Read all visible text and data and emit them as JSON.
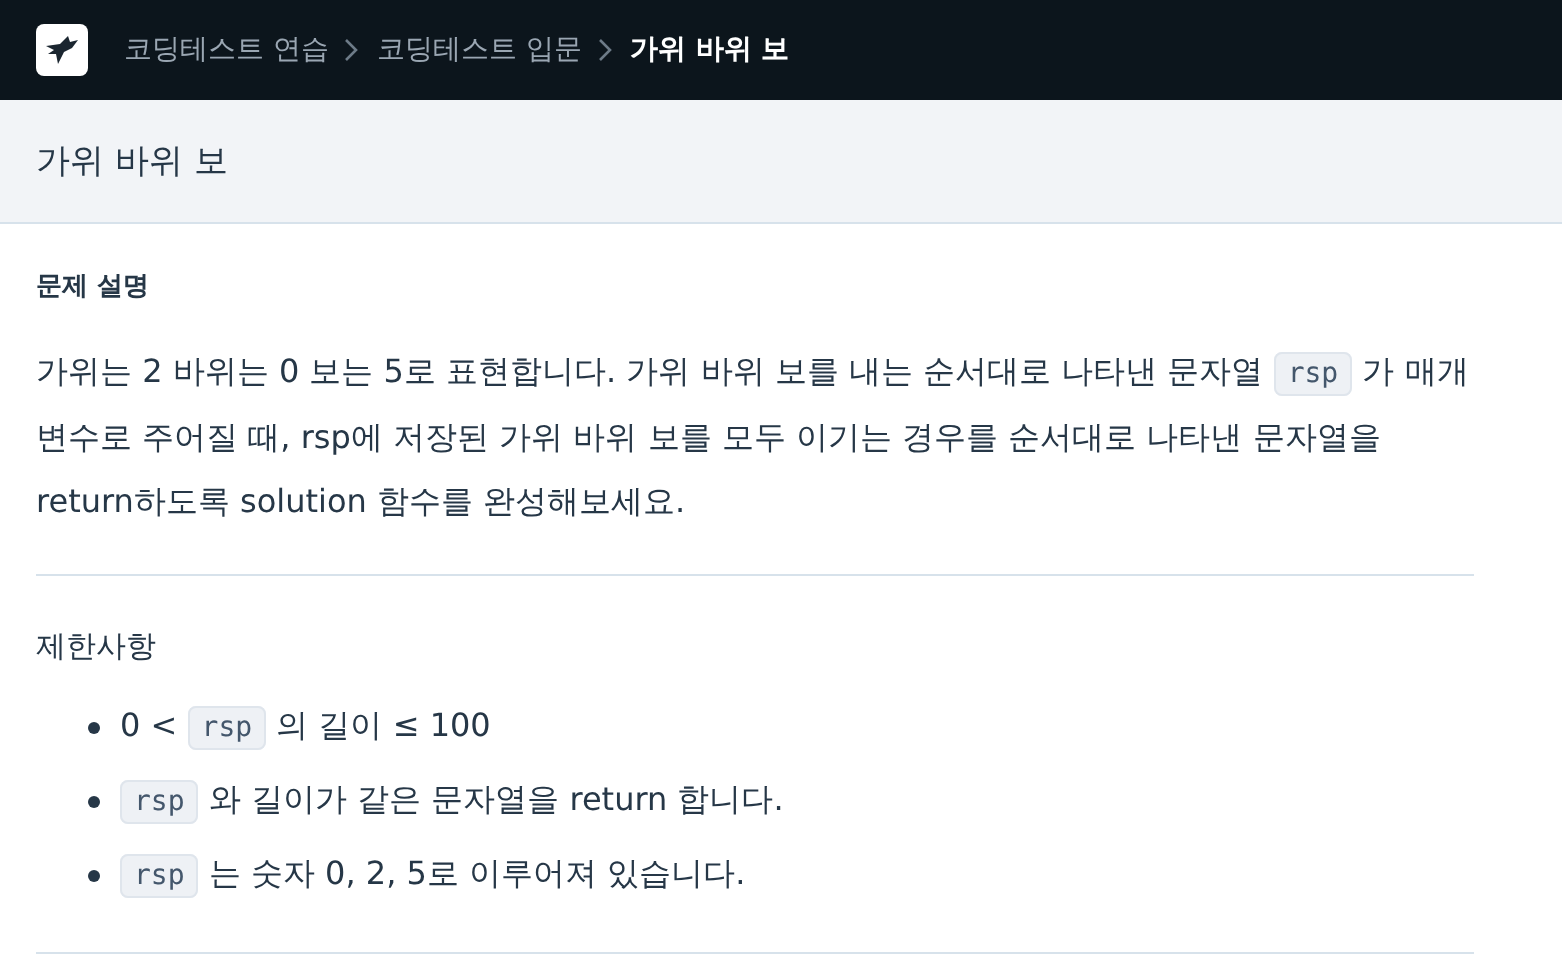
{
  "breadcrumb": [
    {
      "label": "코딩테스트 연습",
      "current": false
    },
    {
      "label": "코딩테스트 입문",
      "current": false
    },
    {
      "label": "가위 바위 보",
      "current": true
    }
  ],
  "title": "가위 바위 보",
  "description": {
    "heading": "문제 설명",
    "paragraph": [
      {
        "kind": "text",
        "text": "가위는 2 바위는 0 보는 5로 표현합니다. 가위 바위 보를 내는 순서대로 나타낸 문자열 "
      },
      {
        "kind": "code",
        "text": "rsp"
      },
      {
        "kind": "text",
        "text": " 가 매개변수로 주어질 때, rsp에 저장된 가위 바위 보를 모두 이기는 경우를 순서대로 나타낸 문자열을 return하도록 solution 함수를 완성해보세요."
      }
    ]
  },
  "constraints": {
    "heading": "제한사항",
    "items": [
      [
        {
          "kind": "text",
          "text": "0 < "
        },
        {
          "kind": "code",
          "text": "rsp"
        },
        {
          "kind": "text",
          "text": " 의 길이 ≤ 100"
        }
      ],
      [
        {
          "kind": "code",
          "text": "rsp"
        },
        {
          "kind": "text",
          "text": " 와 길이가 같은 문자열을 return 합니다."
        }
      ],
      [
        {
          "kind": "code",
          "text": "rsp"
        },
        {
          "kind": "text",
          "text": " 는 숫자 0, 2, 5로 이루어져 있습니다."
        }
      ]
    ]
  }
}
